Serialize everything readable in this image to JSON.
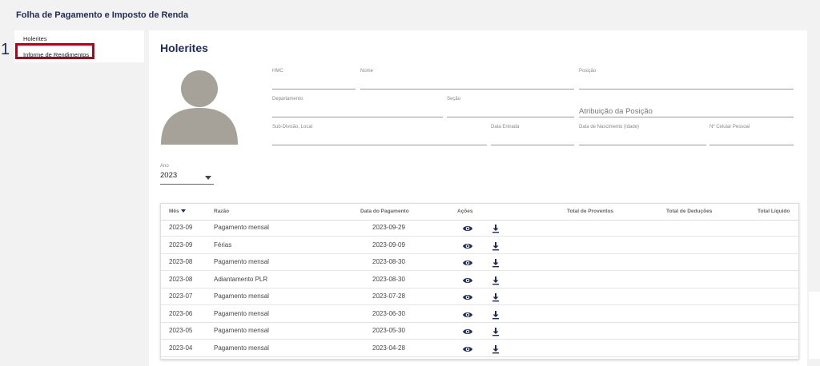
{
  "app": {
    "title": "Folha de Pagamento e Imposto de Renda"
  },
  "annotation": {
    "step_number": "1"
  },
  "sidebar": {
    "items": [
      {
        "label": "Holerites"
      },
      {
        "label": "Informe de Rendimentos"
      }
    ]
  },
  "main": {
    "title": "Holerites",
    "fields": {
      "hmc": {
        "label": "HMC",
        "value": ""
      },
      "nome": {
        "label": "Nome",
        "value": ""
      },
      "posicao": {
        "label": "Posição",
        "value": ""
      },
      "departamento": {
        "label": "Departamento",
        "value": ""
      },
      "secao": {
        "label": "Seção",
        "value": ""
      },
      "atribuicao": {
        "label": "",
        "value": "Atribuição da Posição"
      },
      "subdivisao": {
        "label": "Sub-Divisão, Local",
        "value": ""
      },
      "data_entrada": {
        "label": "Data Entrada",
        "value": ""
      },
      "data_nascimento": {
        "label": "Data de Nascimento (Idade)",
        "value": ""
      },
      "celular": {
        "label": "Nº Celular Pessoal",
        "value": ""
      }
    },
    "year": {
      "label": "Ano",
      "value": "2023"
    }
  },
  "table": {
    "headers": {
      "mes": "Mês",
      "razao": "Razão",
      "data_pagamento": "Data do Pagamento",
      "acoes": "Ações",
      "total_proventos": "Total de Proventos",
      "total_deducoes": "Total de Deduções",
      "total_liquido": "Total Líquido"
    },
    "rows": [
      {
        "mes": "2023-09",
        "razao": "Pagamento mensal",
        "data": "2023-09-29"
      },
      {
        "mes": "2023-09",
        "razao": "Férias",
        "data": "2023-09-09"
      },
      {
        "mes": "2023-08",
        "razao": "Pagamento mensal",
        "data": "2023-08-30"
      },
      {
        "mes": "2023-08",
        "razao": "Adiantamento PLR",
        "data": "2023-08-30"
      },
      {
        "mes": "2023-07",
        "razao": "Pagamento mensal",
        "data": "2023-07-28"
      },
      {
        "mes": "2023-06",
        "razao": "Pagamento mensal",
        "data": "2023-06-30"
      },
      {
        "mes": "2023-05",
        "razao": "Pagamento mensal",
        "data": "2023-05-30"
      },
      {
        "mes": "2023-04",
        "razao": "Pagamento mensal",
        "data": "2023-04-28"
      }
    ]
  },
  "icons": {
    "view": "eye-icon",
    "download": "download-icon",
    "avatar": "user-silhouette-icon"
  },
  "colors": {
    "brand_navy": "#1f2a55",
    "highlight_red": "#b3001b",
    "avatar_gray": "#a6a29a"
  }
}
